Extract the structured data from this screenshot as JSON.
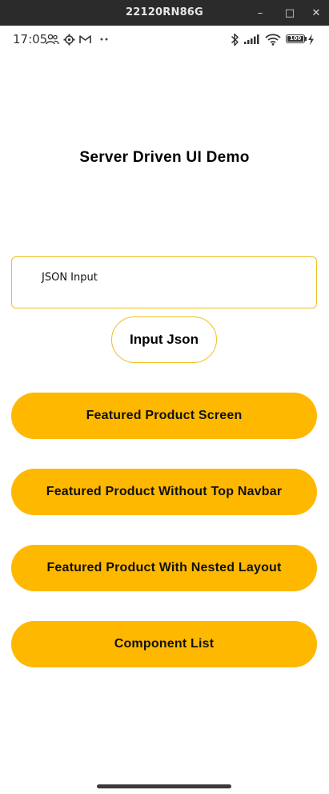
{
  "window": {
    "title": "22120RN86G",
    "min_glyph": "–",
    "max_glyph": "□",
    "close_glyph": "✕"
  },
  "status_bar": {
    "time": "17:05",
    "battery": {
      "label": "100",
      "level": 1.0
    },
    "icons": [
      "people-icon",
      "gear-icon",
      "gmail-icon",
      "more-dots-icon",
      "bluetooth-icon",
      "signal-icon",
      "wifi-icon",
      "battery-icon",
      "charging-icon"
    ]
  },
  "main": {
    "title": "Server Driven UI Demo",
    "json_input": {
      "label": "JSON Input"
    },
    "input_json_button": "Input Json",
    "buttons": [
      {
        "label": "Featured Product Screen"
      },
      {
        "label": "Featured Product Without Top Navbar"
      },
      {
        "label": "Featured Product With Nested Layout"
      },
      {
        "label": "Component List"
      }
    ]
  },
  "colors": {
    "accent": "#ffb800",
    "outline": "#f0c020",
    "window_bar": "#2b2b2b"
  }
}
